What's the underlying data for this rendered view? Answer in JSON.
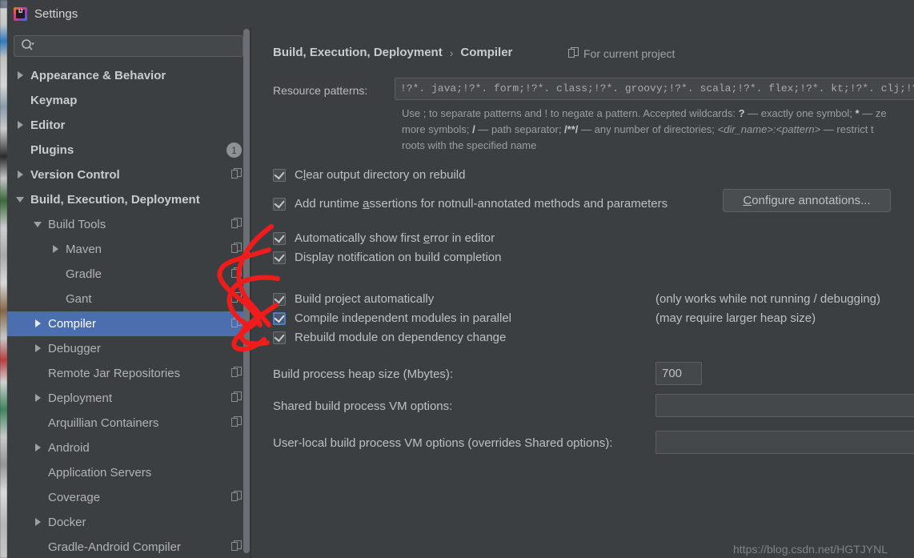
{
  "window": {
    "title": "Settings",
    "logo_text": "IJ",
    "logo_icon": "intellij-idea-logo"
  },
  "sidebar": {
    "search": {
      "placeholder": "",
      "value": "",
      "icon": "search-icon"
    },
    "items": [
      {
        "label": "Appearance & Behavior",
        "indent": 0,
        "arrow": "right",
        "bold": true,
        "copy": false,
        "badge": null,
        "selected": false
      },
      {
        "label": "Keymap",
        "indent": 0,
        "arrow": "none",
        "bold": true,
        "copy": false,
        "badge": null,
        "selected": false
      },
      {
        "label": "Editor",
        "indent": 0,
        "arrow": "right",
        "bold": true,
        "copy": false,
        "badge": null,
        "selected": false
      },
      {
        "label": "Plugins",
        "indent": 0,
        "arrow": "none",
        "bold": true,
        "copy": false,
        "badge": "1",
        "selected": false
      },
      {
        "label": "Version Control",
        "indent": 0,
        "arrow": "right",
        "bold": true,
        "copy": true,
        "badge": null,
        "selected": false
      },
      {
        "label": "Build, Execution, Deployment",
        "indent": 0,
        "arrow": "down",
        "bold": true,
        "copy": false,
        "badge": null,
        "selected": false
      },
      {
        "label": "Build Tools",
        "indent": 1,
        "arrow": "down",
        "bold": false,
        "copy": true,
        "badge": null,
        "selected": false
      },
      {
        "label": "Maven",
        "indent": 2,
        "arrow": "right",
        "bold": false,
        "copy": true,
        "badge": null,
        "selected": false
      },
      {
        "label": "Gradle",
        "indent": 2,
        "arrow": "none",
        "bold": false,
        "copy": true,
        "badge": null,
        "selected": false
      },
      {
        "label": "Gant",
        "indent": 2,
        "arrow": "none",
        "bold": false,
        "copy": true,
        "badge": null,
        "selected": false
      },
      {
        "label": "Compiler",
        "indent": 1,
        "arrow": "right",
        "bold": false,
        "copy": true,
        "badge": null,
        "selected": true
      },
      {
        "label": "Debugger",
        "indent": 1,
        "arrow": "right",
        "bold": false,
        "copy": false,
        "badge": null,
        "selected": false
      },
      {
        "label": "Remote Jar Repositories",
        "indent": 1,
        "arrow": "none",
        "bold": false,
        "copy": true,
        "badge": null,
        "selected": false
      },
      {
        "label": "Deployment",
        "indent": 1,
        "arrow": "right",
        "bold": false,
        "copy": true,
        "badge": null,
        "selected": false
      },
      {
        "label": "Arquillian Containers",
        "indent": 1,
        "arrow": "none",
        "bold": false,
        "copy": true,
        "badge": null,
        "selected": false
      },
      {
        "label": "Android",
        "indent": 1,
        "arrow": "right",
        "bold": false,
        "copy": false,
        "badge": null,
        "selected": false
      },
      {
        "label": "Application Servers",
        "indent": 1,
        "arrow": "none",
        "bold": false,
        "copy": false,
        "badge": null,
        "selected": false
      },
      {
        "label": "Coverage",
        "indent": 1,
        "arrow": "none",
        "bold": false,
        "copy": true,
        "badge": null,
        "selected": false
      },
      {
        "label": "Docker",
        "indent": 1,
        "arrow": "right",
        "bold": false,
        "copy": false,
        "badge": null,
        "selected": false
      },
      {
        "label": "Gradle-Android Compiler",
        "indent": 1,
        "arrow": "none",
        "bold": false,
        "copy": true,
        "badge": null,
        "selected": false
      }
    ]
  },
  "content": {
    "breadcrumb": {
      "parent": "Build, Execution, Deployment",
      "separator": "›",
      "current": "Compiler"
    },
    "project_scope": {
      "icon": "copy-icon",
      "label": "For current project"
    },
    "resource_patterns": {
      "label": "Resource patterns:",
      "value": "!?*. java;!?*. form;!?*. class;!?*. groovy;!?*. scala;!?*. flex;!?*. kt;!?*. clj;!?*. aj",
      "placeholder": ""
    },
    "help_line1_a": "Use ; to separate patterns and ! to negate a pattern. Accepted wildcards: ",
    "help_line1_q": "?",
    "help_line1_b": " — exactly one symbol; ",
    "help_line1_star": "*",
    "help_line1_c": " — ze",
    "help_line2_a": "more symbols; ",
    "help_line2_slash": "/",
    "help_line2_b": " — path separator; ",
    "help_line2_globs": "/**/",
    "help_line2_c": " — any number of directories; ",
    "help_line2_dir": "<dir_name>:<pattern>",
    "help_line2_d": " — restrict t",
    "help_line3": "roots with the specified name",
    "checkboxes": [
      {
        "label_pre": "C",
        "label_mn": "l",
        "label_post": "ear output directory on rebuild",
        "checked": true,
        "focused": false
      },
      {
        "label_pre": "Add runtime ",
        "label_mn": "a",
        "label_post": "ssertions for notnull-annotated methods and parameters",
        "checked": true,
        "focused": false
      },
      {
        "label_pre": "Automatically show first ",
        "label_mn": "e",
        "label_post": "rror in editor",
        "checked": true,
        "focused": false
      },
      {
        "label_pre": "Display notification on build completion",
        "label_mn": "",
        "label_post": "",
        "checked": true,
        "focused": false
      },
      {
        "label_pre": "Build project automatically",
        "label_mn": "",
        "label_post": "",
        "checked": true,
        "focused": false
      },
      {
        "label_pre": "Compile independent modules in parallel",
        "label_mn": "",
        "label_post": "",
        "checked": true,
        "focused": true
      },
      {
        "label_pre": "Rebuild module on dependency change",
        "label_mn": "",
        "label_post": "",
        "checked": true,
        "focused": false
      }
    ],
    "note_build_auto": "(only works while not running / debugging)",
    "note_parallel": "(may require larger heap size)",
    "configure_button": {
      "mnemonic": "C",
      "rest": "onfigure annotations..."
    },
    "fields": [
      {
        "label": "Build process heap size (Mbytes):",
        "value": "700",
        "placeholder": ""
      },
      {
        "label": "Shared build process VM options:",
        "value": "",
        "placeholder": ""
      },
      {
        "label": "User-local build process VM options (overrides Shared options):",
        "value": "",
        "placeholder": ""
      }
    ],
    "watermark": "https://blog.csdn.net/HGTJYNL"
  },
  "annotations": {
    "color": "#f01c1c",
    "kind": "red-pen-scribbles"
  }
}
